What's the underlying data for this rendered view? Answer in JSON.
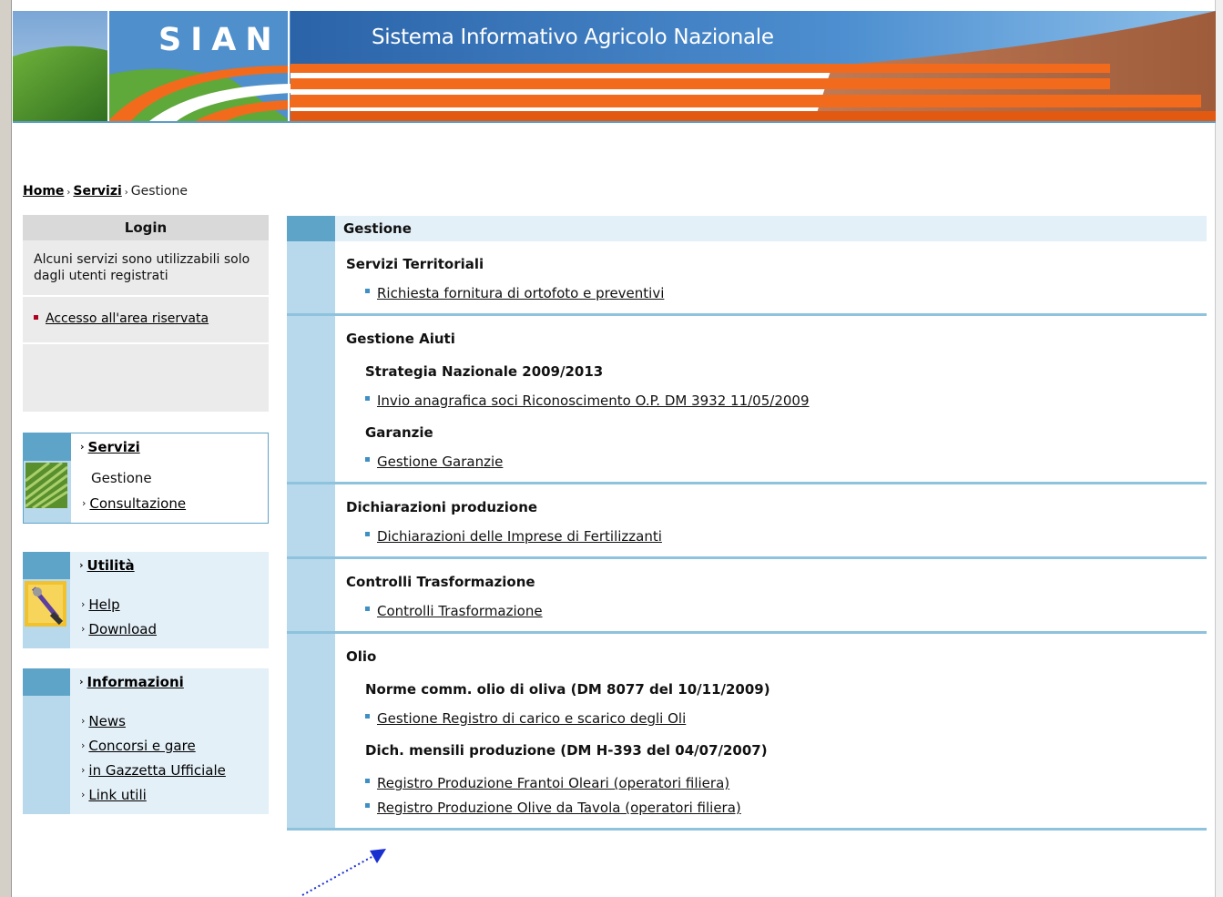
{
  "banner": {
    "logo": "SIAN",
    "title": "Sistema Informativo Agricolo Nazionale"
  },
  "breadcrumb": {
    "home": "Home",
    "servizi": "Servizi",
    "current": "Gestione"
  },
  "login": {
    "title": "Login",
    "text": "Alcuni servizi sono utilizzabili solo dagli utenti registrati",
    "link": "Accesso all'area riservata"
  },
  "sidebar": {
    "servizi": {
      "title": "Servizi",
      "items": [
        "Gestione",
        "Consultazione"
      ]
    },
    "utilita": {
      "title": "Utilità",
      "items": [
        "Help",
        "Download"
      ]
    },
    "informazioni": {
      "title": "Informazioni",
      "items": [
        "News",
        "Concorsi e gare",
        "in Gazzetta Ufficiale",
        "Link utili"
      ]
    }
  },
  "main": {
    "title": "Gestione",
    "sections": [
      {
        "title": "Servizi Territoriali",
        "links": [
          "Richiesta fornitura di ortofoto e preventivi"
        ]
      },
      {
        "title": "Gestione Aiuti",
        "subsections": [
          {
            "title": "Strategia Nazionale 2009/2013",
            "links": [
              "Invio anagrafica soci Riconoscimento O.P. DM 3932 11/05/2009"
            ]
          },
          {
            "title": "Garanzie",
            "links": [
              "Gestione Garanzie"
            ]
          }
        ]
      },
      {
        "title": "Dichiarazioni produzione",
        "links": [
          "Dichiarazioni delle Imprese di Fertilizzanti"
        ]
      },
      {
        "title": "Controlli Trasformazione",
        "links": [
          "Controlli Trasformazione"
        ]
      },
      {
        "title": "Olio",
        "subsections": [
          {
            "title": "Norme comm. olio di oliva (DM 8077 del 10/11/2009)",
            "links": [
              "Gestione Registro di carico e scarico degli Oli"
            ]
          },
          {
            "title": "Dich. mensili produzione (DM H-393 del 04/07/2007)",
            "links": [
              "Registro Produzione Frantoi Oleari (operatori filiera)",
              "Registro Produzione Olive da Tavola (operatori filiera)"
            ]
          }
        ]
      }
    ]
  },
  "colors": {
    "accent_blue": "#5ea3c8",
    "light_blue": "#b8d9ec",
    "orange": "#f26b1d",
    "bullet_red": "#b00020"
  }
}
